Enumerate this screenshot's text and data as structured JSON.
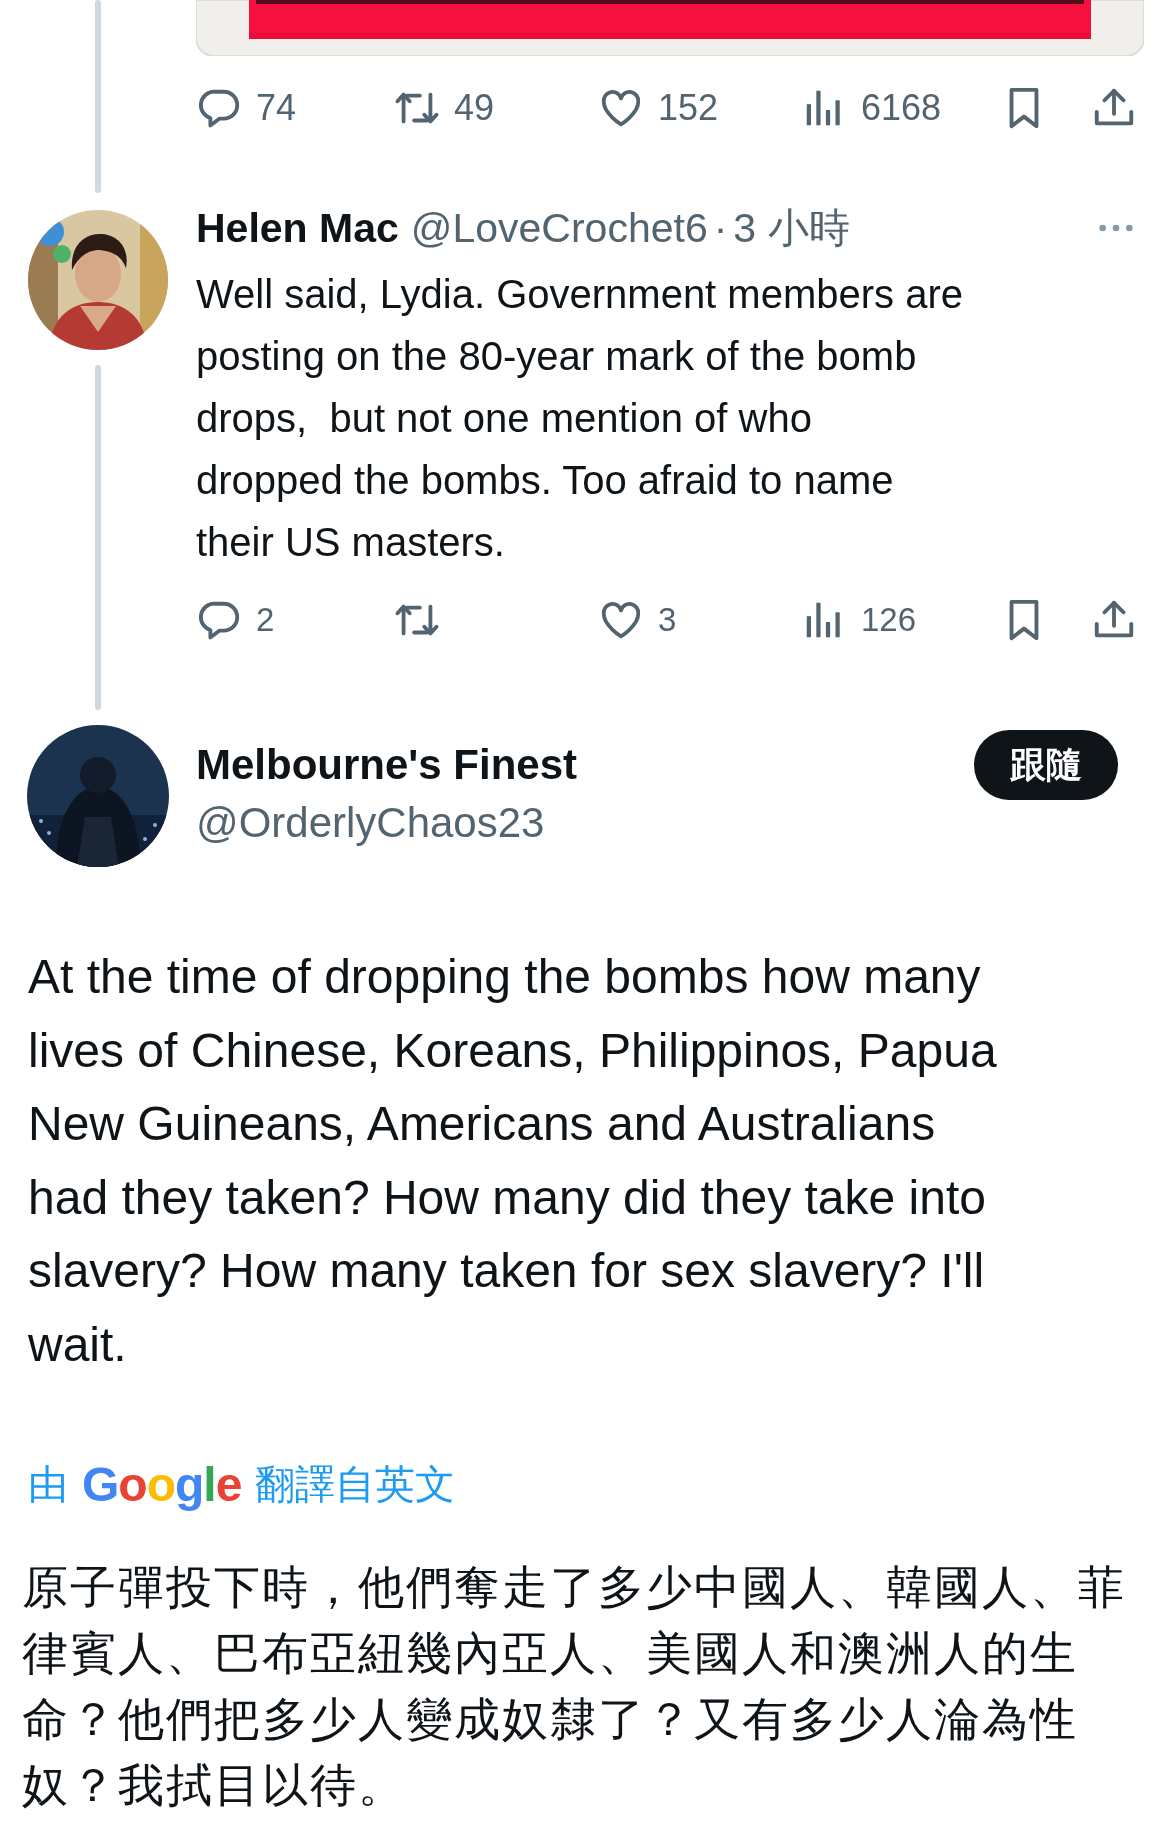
{
  "previous_post": {
    "media": {
      "kind": "picture"
    },
    "actions": [
      {
        "kind": "reply",
        "count": "74"
      },
      {
        "kind": "repost",
        "count": "49"
      },
      {
        "kind": "like",
        "count": "152"
      },
      {
        "kind": "views",
        "count": "6168"
      },
      {
        "kind": "bookmark"
      },
      {
        "kind": "share"
      }
    ]
  },
  "reply": {
    "avatar": {
      "kind": "picture"
    },
    "name": "Helen Mac",
    "handle": "@LoveCrochet6",
    "separator": "·",
    "time": "3 小時",
    "lines": [
      "Well said, Lydia. Government members are",
      "posting on the 80-year mark of the bomb",
      "drops,  but not one mention of who",
      "dropped the bombs. Too afraid to name",
      "their US masters."
    ],
    "actions": [
      {
        "kind": "reply",
        "count": "2"
      },
      {
        "kind": "repost"
      },
      {
        "kind": "like",
        "count": "3"
      },
      {
        "kind": "views",
        "count": "126"
      },
      {
        "kind": "bookmark"
      },
      {
        "kind": "share"
      }
    ]
  },
  "main_post": {
    "avatar": {
      "kind": "picture"
    },
    "name": "Melbourne's Finest",
    "handle": "@OrderlyChaos23",
    "follow_button": "跟隨",
    "lines": [
      "At the time of dropping the bombs how many",
      "lives of Chinese, Koreans, Philippinos, Papua",
      "New Guineans, Americans and Australians",
      "had they taken? How many did they take into",
      "slavery? How many taken for sex slavery? I'll",
      "wait."
    ],
    "translation": {
      "prefix": "由",
      "brand": "Google",
      "suffix": "翻譯自英文",
      "lines": [
        "原子彈投下時，他們奪走了多少中國人、韓國人、菲",
        "律賓人、巴布亞紐幾內亞人、美國人和澳洲人的生",
        "命？他們把多少人變成奴隸了？又有多少人淪為性",
        "奴？我拭目以待。"
      ]
    }
  }
}
